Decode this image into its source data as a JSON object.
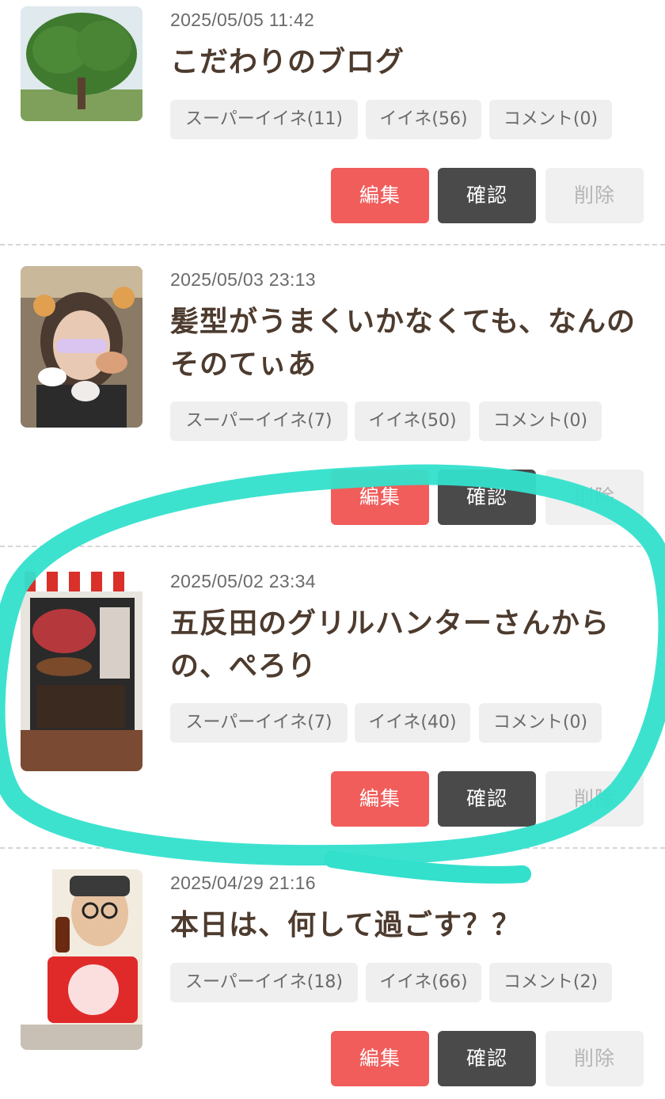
{
  "posts": [
    {
      "date": "2025/05/05 11:42",
      "title": "こだわりのブログ",
      "super_like": "スーパーイイネ(11)",
      "like": "イイネ(56)",
      "comment": "コメント(0)",
      "edit": "編集",
      "confirm": "確認",
      "delete": "削除"
    },
    {
      "date": "2025/05/03 23:13",
      "title": "髪型がうまくいかなくても、なんのそのてぃあ",
      "super_like": "スーパーイイネ(7)",
      "like": "イイネ(50)",
      "comment": "コメント(0)",
      "edit": "編集",
      "confirm": "確認",
      "delete": "削除"
    },
    {
      "date": "2025/05/02 23:34",
      "title": "五反田のグリルハンターさんからの、ぺろり",
      "super_like": "スーパーイイネ(7)",
      "like": "イイネ(40)",
      "comment": "コメント(0)",
      "edit": "編集",
      "confirm": "確認",
      "delete": "削除"
    },
    {
      "date": "2025/04/29 21:16",
      "title": "本日は、何して過ごす？？",
      "super_like": "スーパーイイネ(18)",
      "like": "イイネ(66)",
      "comment": "コメント(2)",
      "edit": "編集",
      "confirm": "確認",
      "delete": "削除"
    }
  ],
  "colors": {
    "edit": "#f05d5b",
    "confirm": "#4a4a4a",
    "delete_bg": "#f0f0f0",
    "annotation": "#33e0cc"
  }
}
